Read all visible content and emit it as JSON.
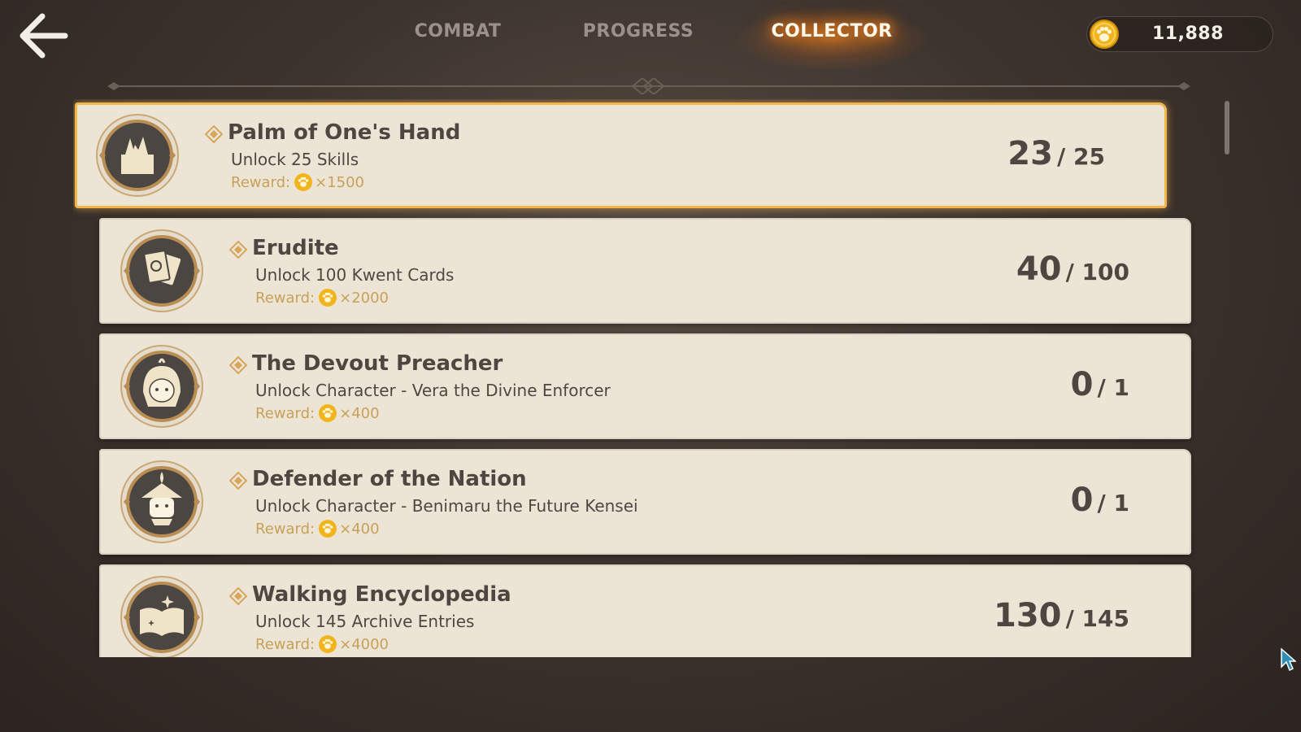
{
  "header": {
    "tabs": [
      {
        "label": "COMBAT",
        "active": false
      },
      {
        "label": "PROGRESS",
        "active": false
      },
      {
        "label": "COLLECTOR",
        "active": true
      }
    ],
    "currency": {
      "icon": "paw-coin-icon",
      "value": "11,888"
    }
  },
  "colors": {
    "accent_glow": "#ff8a1e",
    "card_bg": "#ece5d6",
    "reward_text": "#c9a058",
    "selected_border": "#f0b64a"
  },
  "achievements": [
    {
      "title": "Palm of One's Hand",
      "description": "Unlock 25 Skills",
      "reward_label": "Reward:",
      "reward_amount": "×1500",
      "current": "23",
      "total": "/ 25",
      "icon": "skills-chest-icon",
      "selected": true
    },
    {
      "title": "Erudite",
      "description": "Unlock 100 Kwent Cards",
      "reward_label": "Reward:",
      "reward_amount": "×2000",
      "current": "40",
      "total": "/ 100",
      "icon": "cards-icon",
      "selected": false
    },
    {
      "title": "The Devout Preacher",
      "description": "Unlock Character - Vera the Divine Enforcer",
      "reward_label": "Reward:",
      "reward_amount": "×400",
      "current": "0",
      "total": "/ 1",
      "icon": "character-portrait-icon",
      "selected": false
    },
    {
      "title": "Defender of the Nation",
      "description": "Unlock Character - Benimaru the Future Kensei",
      "reward_label": "Reward:",
      "reward_amount": "×400",
      "current": "0",
      "total": "/ 1",
      "icon": "samurai-portrait-icon",
      "selected": false
    },
    {
      "title": "Walking Encyclopedia",
      "description": "Unlock 145 Archive Entries",
      "reward_label": "Reward:",
      "reward_amount": "×4000",
      "current": "130",
      "total": "/ 145",
      "icon": "open-book-icon",
      "selected": false
    }
  ]
}
